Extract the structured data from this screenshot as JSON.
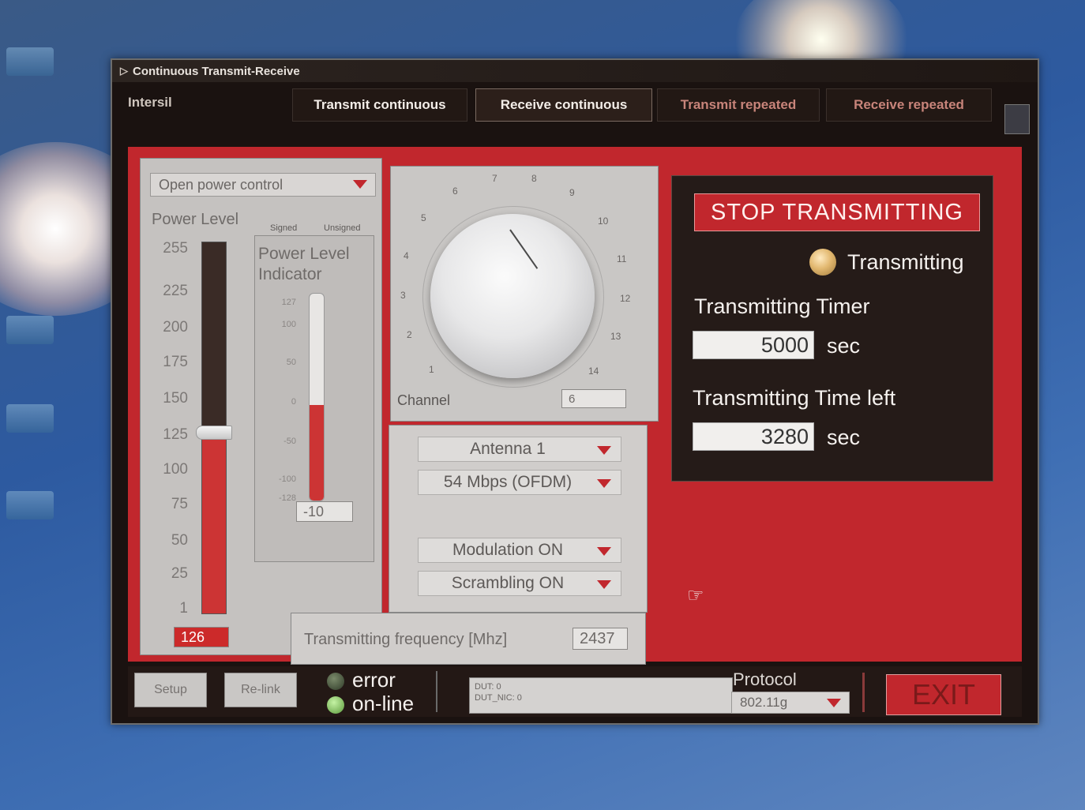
{
  "window": {
    "title": "Continuous Transmit-Receive"
  },
  "menu": {
    "brand": "Intersil",
    "tabs": [
      "Transmit continuous",
      "Receive continuous",
      "Transmit repeated",
      "Receive repeated"
    ]
  },
  "power": {
    "control_dropdown": "Open power control",
    "level_label": "Power Level",
    "signed_label": "Signed",
    "unsigned_label": "Unsigned",
    "scale_ticks": [
      "255",
      "225",
      "200",
      "175",
      "150",
      "125",
      "100",
      "75",
      "50",
      "25",
      "1"
    ],
    "value": "126",
    "level_fraction": 0.49
  },
  "indicator": {
    "title_line1": "Power Level",
    "title_line2": "Indicator",
    "ticks": [
      "127",
      "100",
      "50",
      "0",
      "-50",
      "-100",
      "-128"
    ],
    "value": "-10",
    "level_fraction": 0.46
  },
  "channel": {
    "label": "Channel",
    "value": "6",
    "dial_numbers": [
      "1",
      "2",
      "3",
      "4",
      "5",
      "6",
      "7",
      "8",
      "9",
      "10",
      "11",
      "12",
      "13",
      "14"
    ]
  },
  "settings": {
    "antenna": "Antenna 1",
    "rate": "54 Mbps (OFDM)",
    "modulation": "Modulation ON",
    "scrambling": "Scrambling ON"
  },
  "frequency": {
    "label": "Transmitting frequency [Mhz]",
    "value": "2437"
  },
  "transmit": {
    "stop_button": "STOP TRANSMITTING",
    "status_label": "Transmitting",
    "timer_label": "Transmitting Timer",
    "timer_value": "5000",
    "timer_unit": "sec",
    "left_label": "Transmitting Time left",
    "left_value": "3280",
    "left_unit": "sec"
  },
  "bottom": {
    "setup_button": "Setup",
    "relink_button": "Re-link",
    "error_label": "error",
    "online_label": "on-line",
    "status_line1": "DUT:  0",
    "status_line2": "DUT_NIC:  0",
    "protocol_label": "Protocol",
    "protocol_value": "802.11g",
    "exit_button": "EXIT"
  }
}
